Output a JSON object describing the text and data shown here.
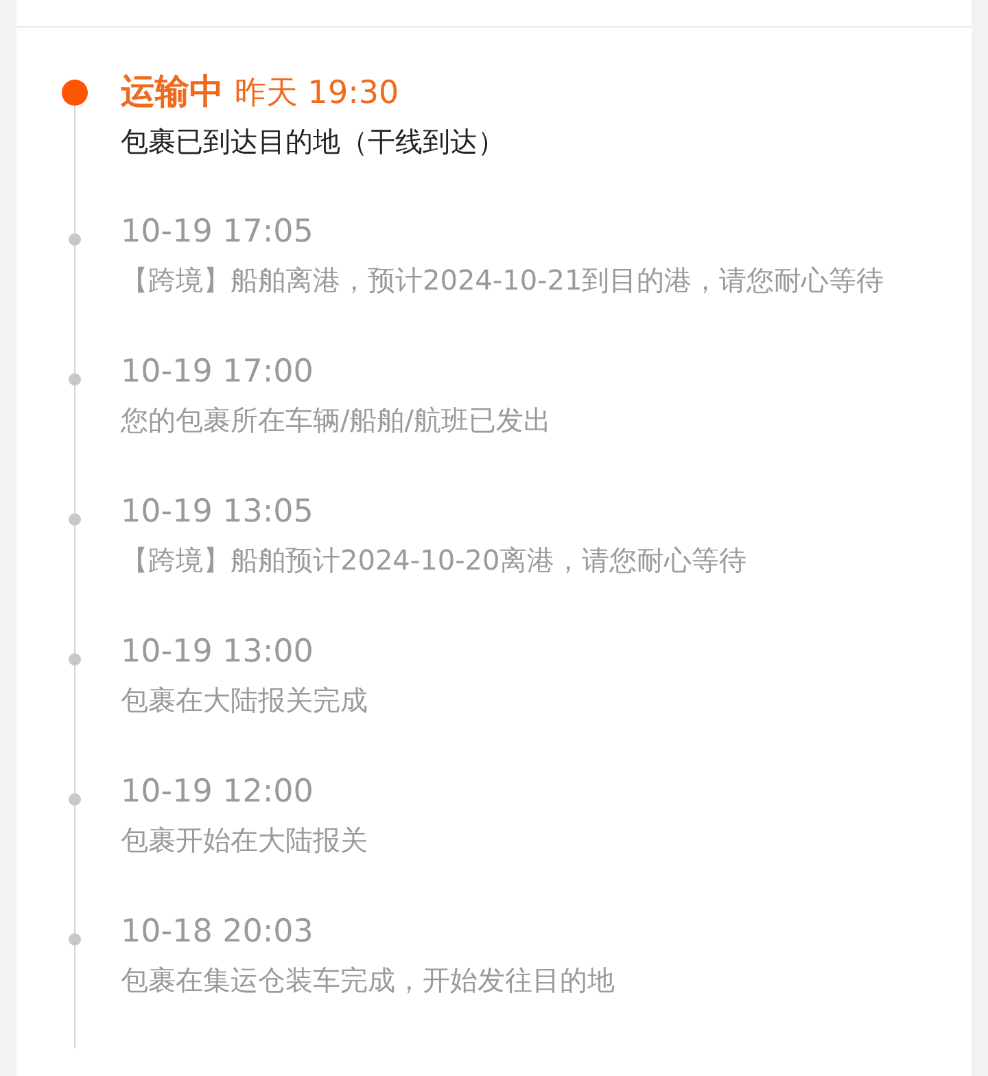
{
  "timeline": [
    {
      "current": true,
      "status": "运输中",
      "time": "昨天 19:30",
      "description": "包裹已到达目的地（干线到达）"
    },
    {
      "current": false,
      "time": "10-19 17:05",
      "description": "【跨境】船舶离港，预计2024-10-21到目的港，请您耐心等待"
    },
    {
      "current": false,
      "time": "10-19 17:00",
      "description": "您的包裹所在车辆/船舶/航班已发出"
    },
    {
      "current": false,
      "time": "10-19 13:05",
      "description": "【跨境】船舶预计2024-10-20离港，请您耐心等待"
    },
    {
      "current": false,
      "time": "10-19 13:00",
      "description": "包裹在大陆报关完成"
    },
    {
      "current": false,
      "time": "10-19 12:00",
      "description": "包裹开始在大陆报关"
    },
    {
      "current": false,
      "time": "10-18 20:03",
      "description": "包裹在集运仓装车完成，开始发往目的地"
    }
  ]
}
